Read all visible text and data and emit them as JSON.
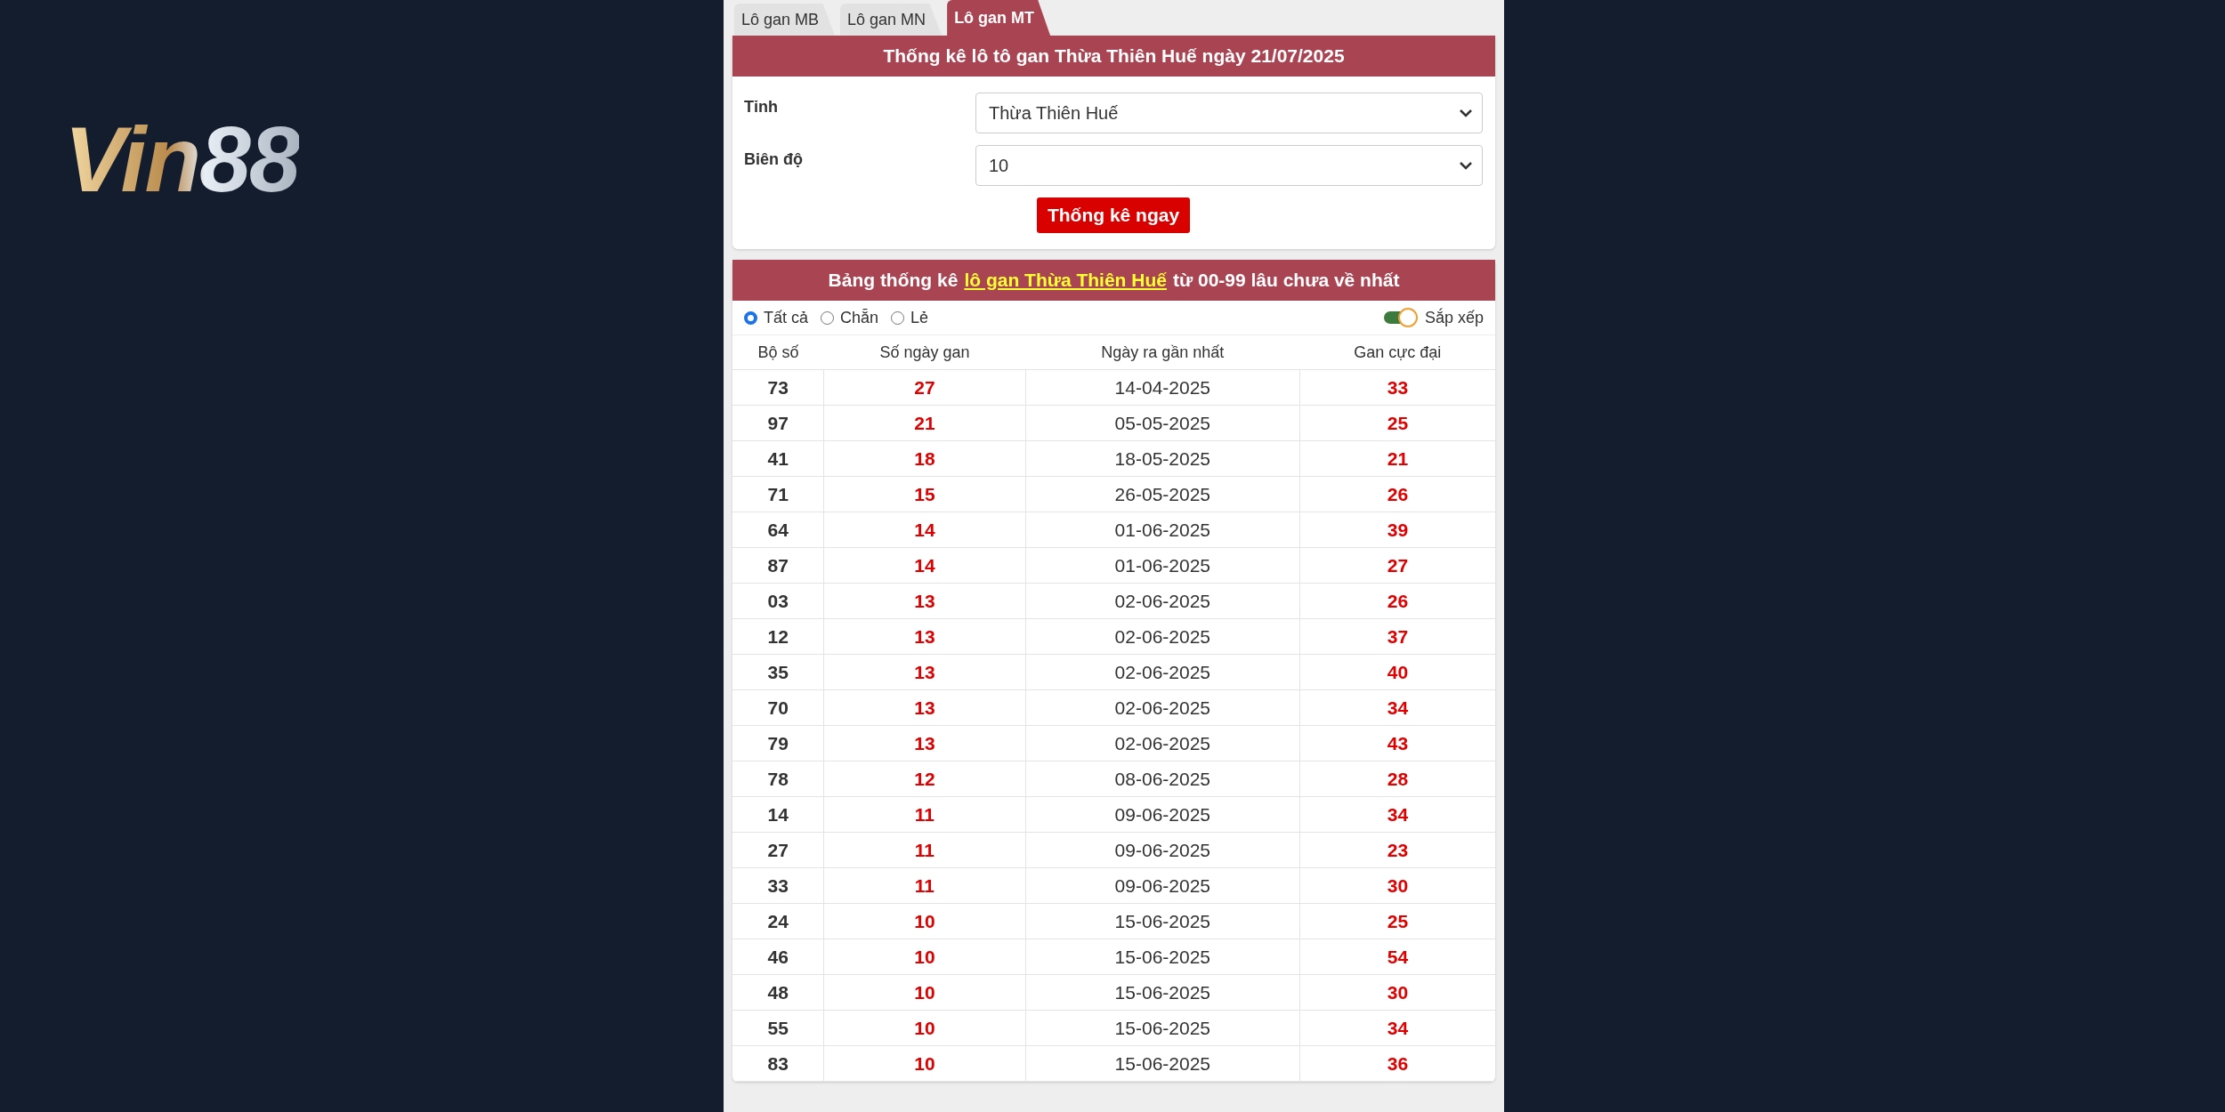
{
  "logo": "Vin88",
  "tabs": [
    {
      "label": "Lô gan MB",
      "selected": false
    },
    {
      "label": "Lô gan MN",
      "selected": false
    },
    {
      "label": "Lô gan MT",
      "selected": true
    }
  ],
  "form": {
    "title": "Thống kê lô tô gan Thừa Thiên Huế ngày 21/07/2025",
    "fields": [
      {
        "label": "Tỉnh",
        "value": "Thừa Thiên Huế"
      },
      {
        "label": "Biên độ",
        "value": "10"
      }
    ],
    "submit": "Thống kê ngay"
  },
  "table_section": {
    "title_before": "Bảng thống kê",
    "title_link": "lô gan Thừa Thiên Huế",
    "title_after": "từ 00-99 lâu chưa về nhất",
    "filters": [
      {
        "label": "Tất cả",
        "selected": true
      },
      {
        "label": "Chẵn",
        "selected": false
      },
      {
        "label": "Lẻ",
        "selected": false
      }
    ],
    "sort_toggle": {
      "label": "Sắp xếp",
      "on": true
    },
    "columns": [
      "Bộ số",
      "Số ngày gan",
      "Ngày ra gần nhất",
      "Gan cực đại"
    ],
    "rows": [
      [
        "73",
        "27",
        "14-04-2025",
        "33"
      ],
      [
        "97",
        "21",
        "05-05-2025",
        "25"
      ],
      [
        "41",
        "18",
        "18-05-2025",
        "21"
      ],
      [
        "71",
        "15",
        "26-05-2025",
        "26"
      ],
      [
        "64",
        "14",
        "01-06-2025",
        "39"
      ],
      [
        "87",
        "14",
        "01-06-2025",
        "27"
      ],
      [
        "03",
        "13",
        "02-06-2025",
        "26"
      ],
      [
        "12",
        "13",
        "02-06-2025",
        "37"
      ],
      [
        "35",
        "13",
        "02-06-2025",
        "40"
      ],
      [
        "70",
        "13",
        "02-06-2025",
        "34"
      ],
      [
        "79",
        "13",
        "02-06-2025",
        "43"
      ],
      [
        "78",
        "12",
        "08-06-2025",
        "28"
      ],
      [
        "14",
        "11",
        "09-06-2025",
        "34"
      ],
      [
        "27",
        "11",
        "09-06-2025",
        "23"
      ],
      [
        "33",
        "11",
        "09-06-2025",
        "30"
      ],
      [
        "24",
        "10",
        "15-06-2025",
        "25"
      ],
      [
        "46",
        "10",
        "15-06-2025",
        "54"
      ],
      [
        "48",
        "10",
        "15-06-2025",
        "30"
      ],
      [
        "55",
        "10",
        "15-06-2025",
        "34"
      ],
      [
        "83",
        "10",
        "15-06-2025",
        "36"
      ]
    ]
  }
}
